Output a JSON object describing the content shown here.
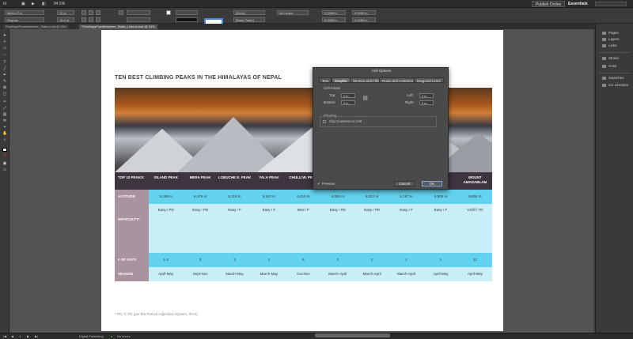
{
  "menubar": {
    "zoom": "94.5%",
    "publish_online": "Publish Online",
    "workspace": "Essentials",
    "menus": [
      "Ps",
      "■",
      "▶",
      "◧"
    ]
  },
  "control": {
    "font_family": "Minion Pro",
    "font_style": "Regular",
    "size1": "12 pt",
    "size2": "14.4 pt",
    "field_a": "[None]",
    "field_b": "[Basic Table]",
    "field_c": "All Levels",
    "field_d": "0.0556 in",
    "field_e": "0.0556 in",
    "field_f": "0.0556 in",
    "field_g": "0.0556 in"
  },
  "tabs": [
    "FiveDaysFromNowhere_Static.indd @ 93%",
    "*FiveDaysFromNowhere_Static_Linked.indd @ 94%"
  ],
  "right_panel": {
    "items": [
      "Pages",
      "Layers",
      "Links",
      "Stroke",
      "Color",
      "Swatches",
      "CC Libraries"
    ]
  },
  "page": {
    "title": "TEN BEST CLIMBING PEAKS IN THE HIMALAYAS OF NEPAL",
    "footnote": "* PD, F, TD (per the French Adjectival System, IFAS)"
  },
  "table": {
    "header_label": "TOP 10 PEAKS:",
    "peaks": [
      "ISLAND PEAK",
      "MERA PEAK",
      "LOBUCHE E. PEAK",
      "YALA PEAK",
      "CHULU W. PEAK",
      "",
      "",
      "",
      "…DE",
      "MOUNT AMADABLAM"
    ],
    "rows": [
      {
        "label": "ALTITUDE",
        "values": [
          "6,189 m",
          "6,476 m",
          "6,119 m",
          "5,520 m",
          "6,419 m",
          "6,092 m",
          "6,012 m",
          "6,187 m",
          "5,806 m",
          "6,856 m"
        ]
      },
      {
        "label": "DIFFICULTY*",
        "values": [
          "Easy / PD",
          "Easy / PD",
          "Easy / F",
          "Easy / F",
          "Med / F",
          "Easy / PD",
          "Easy / PD",
          "Easy / F",
          "Easy / F",
          "V.Diff / TD"
        ]
      },
      {
        "label": "# OF DAYS",
        "values": [
          "1-2",
          "3",
          "3",
          "1",
          "6",
          "2",
          "2",
          "1",
          "1",
          "12"
        ]
      },
      {
        "label": "SEASON",
        "values": [
          "April-May",
          "Sept-Nov",
          "March-May",
          "March-May",
          "Oct-Nov",
          "March-April",
          "March-April",
          "March-April",
          "April-May",
          "April-May"
        ]
      }
    ]
  },
  "dialog": {
    "title": "Cell Options",
    "tabs": [
      "Text",
      "Graphic",
      "Strokes and Fills",
      "Rows and Columns",
      "Diagonal Lines"
    ],
    "cell_insets_label": "Cell Insets",
    "top_label": "Top:",
    "top_value": "0 in",
    "bottom_label": "Bottom:",
    "bottom_value": "0 in",
    "left_label": "Left:",
    "left_value": "0 in",
    "right_label": "Right:",
    "right_value": "0 in",
    "clipping_label": "Clipping",
    "clip_contents_label": "Clip Contents to Cell",
    "preview_label": "Preview",
    "cancel_label": "Cancel",
    "ok_label": "OK"
  },
  "status": {
    "page_num": "1",
    "profile": "Digital Publishing",
    "errors": "No errors"
  }
}
